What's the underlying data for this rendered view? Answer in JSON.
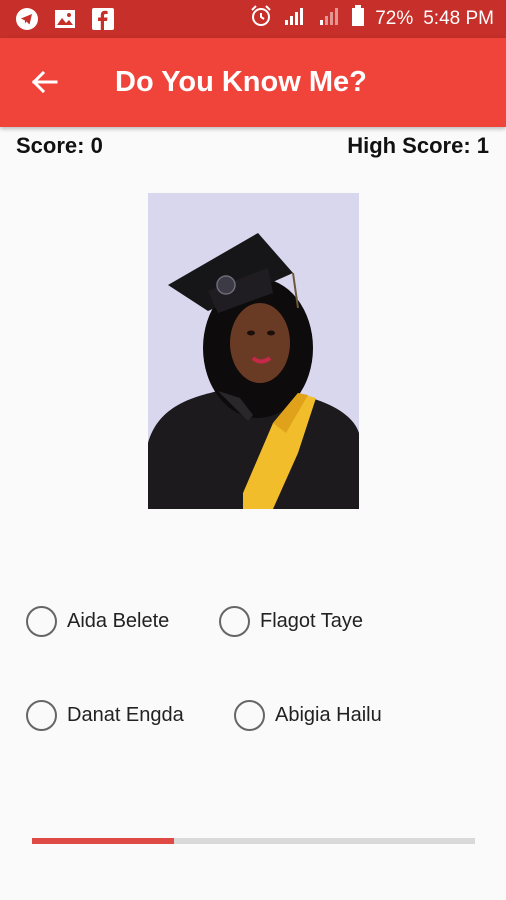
{
  "status_bar": {
    "battery_text": "72%",
    "time_text": "5:48 PM",
    "icons_left": [
      "telegram-icon",
      "image-icon",
      "facebook-icon"
    ],
    "icons_right": [
      "alarm-icon",
      "signal-icon",
      "signal-weak-icon",
      "battery-icon"
    ]
  },
  "app_bar": {
    "title": "Do You Know Me?",
    "background": "#f0433a"
  },
  "scores": {
    "score_text": "Score: 0",
    "high_score_text": "High Score: 1"
  },
  "photo": {
    "description_icon": "graduate-photo"
  },
  "options": [
    {
      "label": "Aida Belete",
      "selected": false
    },
    {
      "label": "Flagot Taye",
      "selected": false
    },
    {
      "label": "Danat Engda",
      "selected": false
    },
    {
      "label": "Abigia Hailu",
      "selected": false
    }
  ],
  "progress": {
    "fraction": 0.32,
    "fill_color": "#e04a45",
    "track_color": "#d9d9d9"
  }
}
